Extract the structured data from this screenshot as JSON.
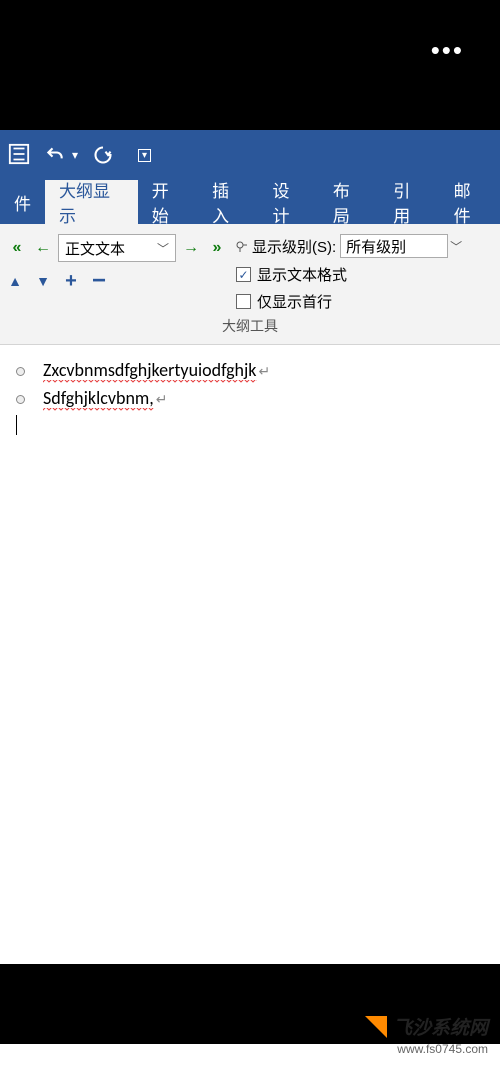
{
  "qat": {
    "save": "保存",
    "undo": "撤销",
    "redo": "恢复"
  },
  "tabs": {
    "file": "件",
    "outline": "大纲显示",
    "home": "开始",
    "insert": "插入",
    "design": "设计",
    "layout": "布局",
    "references": "引用",
    "mailings": "邮件"
  },
  "ribbon": {
    "body_text": "正文文本",
    "show_level_label": "显示级别(S):",
    "show_level_value": "所有级别",
    "show_formatting": "显示文本格式",
    "show_first_line": "仅显示首行",
    "group_label": "大纲工具"
  },
  "doc": {
    "line1": "Zxcvbnmsdfghjkertyuiodfghjk",
    "line2": "Sdfghjklcvbnm,"
  },
  "watermark": {
    "text": "飞沙系统网",
    "url": "www.fs0745.com"
  }
}
